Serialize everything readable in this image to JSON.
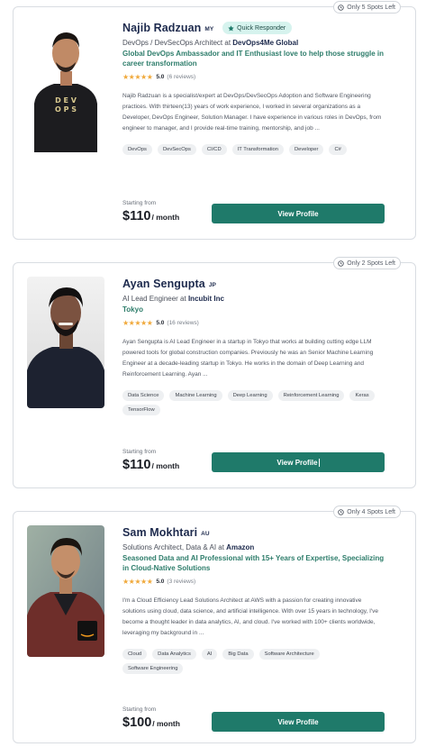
{
  "ui": {
    "starting_label": "Starting from",
    "per_label": "/ month",
    "button_label": "View Profile",
    "colors": {
      "accent": "#1f7a6a",
      "headline": "#2e7d6b",
      "star": "#f0a93b",
      "badge_bg": "#d6f3ee"
    }
  },
  "mentors": [
    {
      "spots": "Only 5 Spots Left",
      "name": "Najib Radzuan",
      "country": "MY",
      "badge": "Quick Responder",
      "role_prefix": "DevOps / DevSecOps Architect at ",
      "company": "DevOps4Me Global",
      "headline": "Global DevOps Ambassador and IT Enthusiast love to help those struggle in career transformation",
      "location": "",
      "stars": "★★★★★",
      "rating": "5.0",
      "reviews": "(6 reviews)",
      "bio": "Najib Radzuan is a specialist/expert at DevOps/DevSecOps Adoption and Software Engineering practices. With thirteen(13) years of work experience, I worked in several organizations as a Developer, DevOps Engineer, Solution Manager. I have experience in various roles in DevOps, from engineer to manager, and I provide real-time training, mentorship, and job ...",
      "tags": [
        "DevOps",
        "DevSecOps",
        "CI/CD",
        "IT Transformation",
        "Developer",
        "C#"
      ],
      "price": "$110",
      "photo_text": [
        "D E V",
        "O P S"
      ]
    },
    {
      "spots": "Only 2 Spots Left",
      "name": "Ayan Sengupta",
      "country": "JP",
      "badge": "",
      "role_prefix": "AI Lead Engineer at ",
      "company": "Incubit Inc",
      "headline": "",
      "location": "Tokyo",
      "stars": "★★★★★",
      "rating": "5.0",
      "reviews": "(16 reviews)",
      "bio": "Ayan Sengupta is AI Lead Engineer in a startup in Tokyo that works at building cutting edge LLM powered tools for global construction companies. Previously he was an Senior Machine Learning Engineer at a decade-leading startup in Tokyo. He works in the domain of Deep Learning and Reinforcement Learning. Ayan ...",
      "tags": [
        "Data Science",
        "Machine Learning",
        "Deep Learning",
        "Reinforcement Learning",
        "Keras",
        "TensorFlow"
      ],
      "price": "$110",
      "photo_text": [
        "",
        ""
      ]
    },
    {
      "spots": "Only 4 Spots Left",
      "name": "Sam Mokhtari",
      "country": "AU",
      "badge": "",
      "role_prefix": "Solutions Architect, Data & AI at ",
      "company": "Amazon",
      "headline": "Seasoned Data and AI Professional with 15+ Years of Expertise, Specializing in Cloud-Native Solutions",
      "location": "",
      "stars": "★★★★★",
      "rating": "5.0",
      "reviews": "(3 reviews)",
      "bio": "I'm a Cloud Efficiency Lead Solutions Architect at AWS with a passion for creating innovative solutions using cloud, data science, and artificial intelligence. With over 15 years in technology, I've become a thought leader in data analytics, AI, and cloud. I've worked with 100+ clients worldwide, leveraging my background in ...",
      "tags": [
        "Cloud",
        "Data Analytics",
        "AI",
        "Big Data",
        "Software Architecture",
        "Software Engineering"
      ],
      "price": "$100",
      "photo_text": [
        "",
        ""
      ]
    }
  ]
}
